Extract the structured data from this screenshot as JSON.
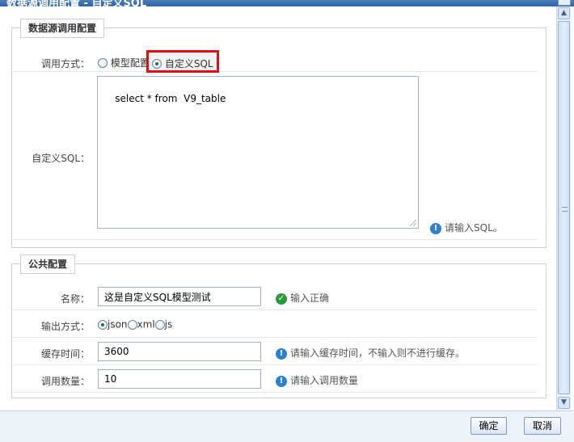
{
  "window": {
    "title": "数据源调用配置 - 自定义SQL"
  },
  "datasource_section": {
    "legend": "数据源调用配置",
    "call_method": {
      "label": "调用方式：",
      "options": [
        "模型配置",
        "自定义SQL"
      ],
      "selected": "自定义SQL"
    },
    "custom_sql": {
      "label": "自定义SQL：",
      "value": "select * from  V9_table",
      "hint": "请输入SQL。"
    }
  },
  "public_section": {
    "legend": "公共配置",
    "name": {
      "label": "名称：",
      "value": "这是自定义SQL模型测试",
      "status": "输入正确"
    },
    "output_method": {
      "label": "输出方式：",
      "options": [
        "json",
        "xml",
        "js"
      ],
      "selected": "json"
    },
    "cache_time": {
      "label": "缓存时间：",
      "value": "3600",
      "hint": "请输入缓存时间，不输入则不进行缓存。"
    },
    "call_count": {
      "label": "调用数量：",
      "value": "10",
      "hint": "请输入调用数量"
    }
  },
  "footer": {
    "confirm_label": "确定",
    "cancel_label": "取消"
  },
  "icons": {
    "info": "info-icon",
    "success": "check-circle-icon",
    "scroll_up": "chevron-up-icon",
    "scroll_down": "chevron-down-icon"
  },
  "colors": {
    "highlight_border": "#e10d17",
    "info_icon": "#2c7fd3",
    "success_icon": "#2a9a3a"
  }
}
